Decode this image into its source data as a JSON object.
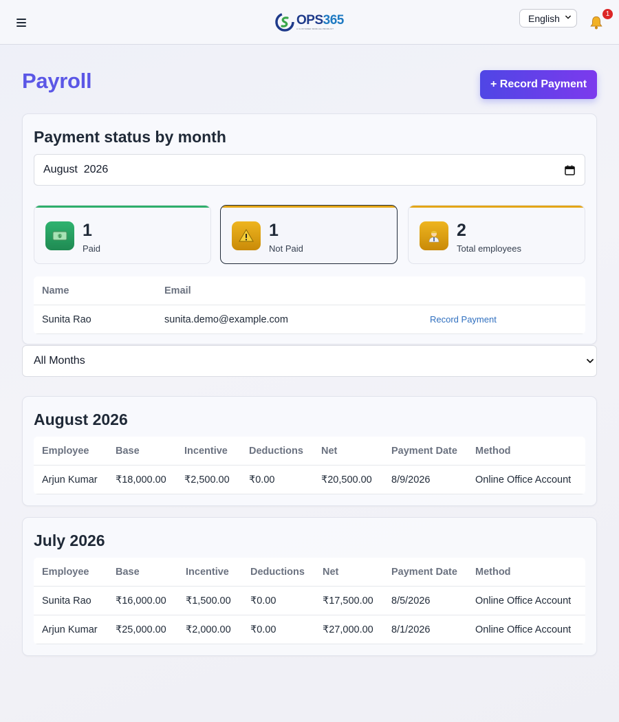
{
  "header": {
    "logo_text_main": "OPS",
    "logo_text_num": "365",
    "logo_tagline": "A CUSTOMER MODULE PRODUCT",
    "language": "English",
    "notification_count": "1"
  },
  "page": {
    "title": "Payroll",
    "record_button": "+ Record Payment"
  },
  "status_card": {
    "title": "Payment status by month",
    "month_value": "August  2026",
    "stats": [
      {
        "value": "1",
        "label": "Paid",
        "icon": "money-icon",
        "color": "#2eaf6b"
      },
      {
        "value": "1",
        "label": "Not Paid",
        "icon": "warning-icon",
        "color": "#e4a616"
      },
      {
        "value": "2",
        "label": "Total employees",
        "icon": "employee-icon",
        "color": "#e4a616"
      }
    ],
    "table": {
      "headers": [
        "Name",
        "Email"
      ],
      "rows": [
        {
          "name": "Sunita Rao",
          "email": "sunita.demo@example.com",
          "action": "Record Payment"
        }
      ]
    }
  },
  "filter": {
    "month_select": "All Months"
  },
  "months": [
    {
      "title": "August 2026",
      "headers": [
        "Employee",
        "Base",
        "Incentive",
        "Deductions",
        "Net",
        "Payment Date",
        "Method"
      ],
      "rows": [
        [
          "Arjun Kumar",
          "₹18,000.00",
          "₹2,500.00",
          "₹0.00",
          "₹20,500.00",
          "8/9/2026",
          "Online Office Account"
        ]
      ]
    },
    {
      "title": "July 2026",
      "headers": [
        "Employee",
        "Base",
        "Incentive",
        "Deductions",
        "Net",
        "Payment Date",
        "Method"
      ],
      "rows": [
        [
          "Sunita Rao",
          "₹16,000.00",
          "₹1,500.00",
          "₹0.00",
          "₹17,500.00",
          "8/5/2026",
          "Online Office Account"
        ],
        [
          "Arjun Kumar",
          "₹25,000.00",
          "₹2,000.00",
          "₹0.00",
          "₹27,000.00",
          "8/1/2026",
          "Online Office Account"
        ]
      ]
    }
  ]
}
